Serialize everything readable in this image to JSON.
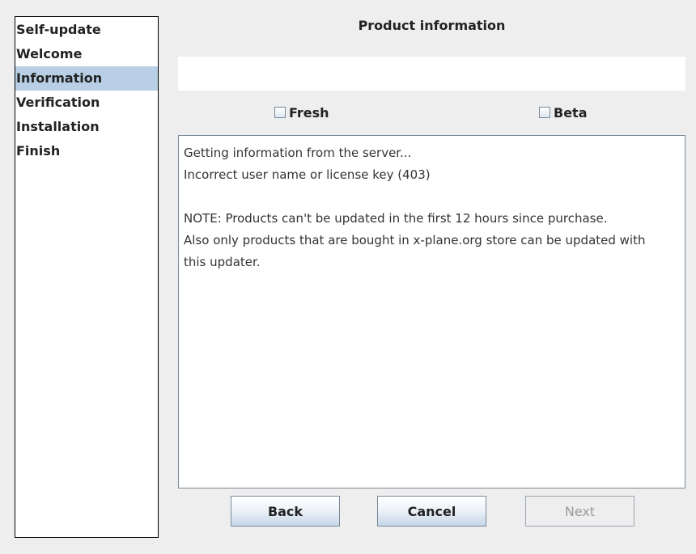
{
  "sidebar": {
    "steps": [
      {
        "label": "Self-update"
      },
      {
        "label": "Welcome"
      },
      {
        "label": "Information"
      },
      {
        "label": "Verification"
      },
      {
        "label": "Installation"
      },
      {
        "label": "Finish"
      }
    ],
    "active_step": "Information"
  },
  "main": {
    "title": "Product information",
    "product_field_value": "",
    "checkboxes": {
      "fresh": {
        "label": "Fresh",
        "checked": false
      },
      "beta": {
        "label": "Beta",
        "checked": false
      }
    },
    "log": {
      "lines": [
        "Getting information from the server...",
        "Incorrect user name or license key (403)",
        "",
        "NOTE: Products can't be updated in the first 12 hours since purchase.",
        "Also only products that are bought in x-plane.org store can be updated with",
        "this updater."
      ]
    }
  },
  "buttons": {
    "back": {
      "label": "Back",
      "enabled": true
    },
    "cancel": {
      "label": "Cancel",
      "enabled": true
    },
    "next": {
      "label": "Next",
      "enabled": false
    }
  },
  "colors": {
    "active_step_bg": "#b8cfe5",
    "window_bg": "#eeeeee"
  }
}
